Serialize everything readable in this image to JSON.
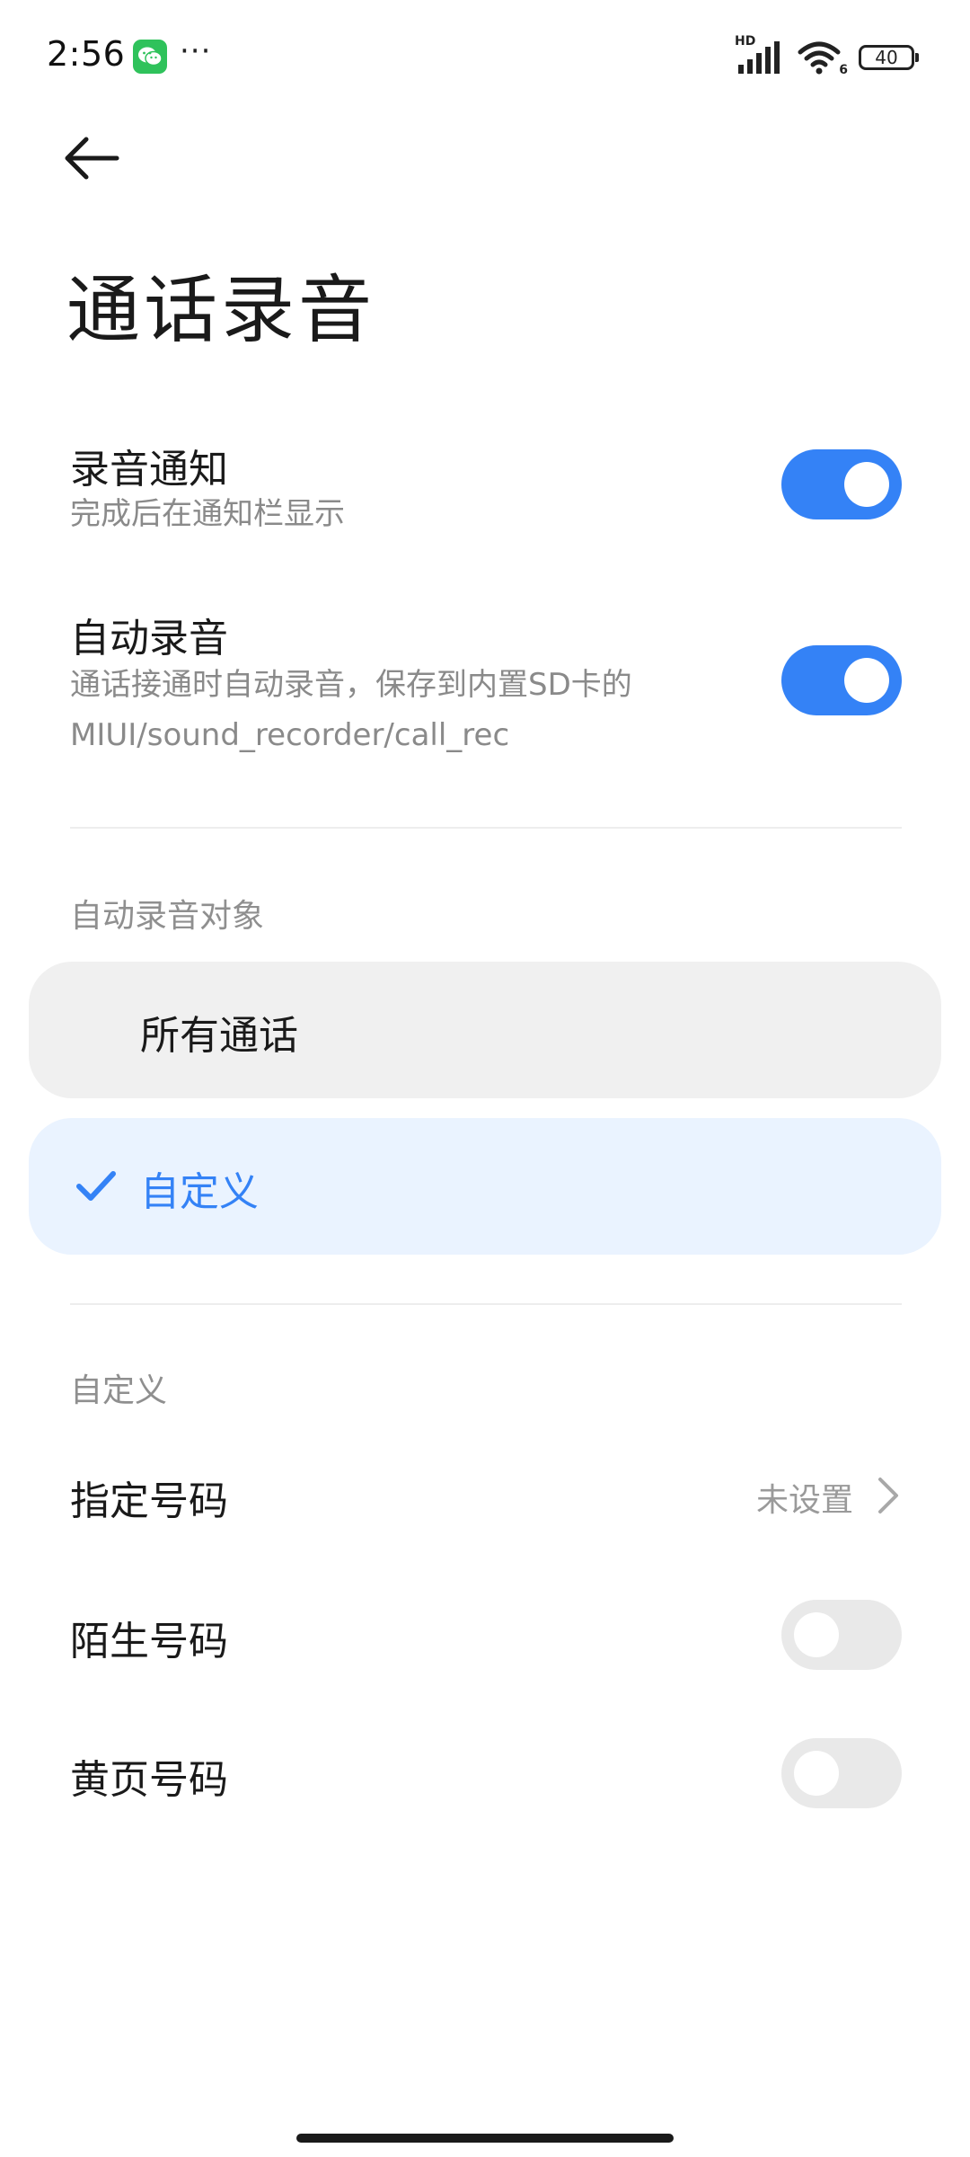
{
  "status_bar": {
    "time": "2:56",
    "app_icon": "wechat-icon",
    "more": "···",
    "network_label": "HD",
    "wifi_label": "6",
    "battery": "40"
  },
  "header": {
    "back_icon": "back-arrow-icon",
    "title": "通话录音"
  },
  "settings": {
    "record_notice": {
      "title": "录音通知",
      "subtitle": "完成后在通知栏显示",
      "enabled": true
    },
    "auto_record": {
      "title": "自动录音",
      "subtitle_line1": "通话接通时自动录音，保存到内置SD卡的",
      "subtitle_line2": "MIUI/sound_recorder/call_rec",
      "enabled": true
    }
  },
  "target_section": {
    "header": "自动录音对象",
    "options": [
      {
        "label": "所有通话",
        "selected": false
      },
      {
        "label": "自定义",
        "selected": true
      }
    ]
  },
  "custom_section": {
    "header": "自定义",
    "specified_numbers": {
      "title": "指定号码",
      "value": "未设置"
    },
    "unknown_numbers": {
      "title": "陌生号码",
      "enabled": false
    },
    "yellow_pages": {
      "title": "黄页号码",
      "enabled": false
    }
  },
  "colors": {
    "accent": "#3482f6",
    "toggle_off": "#e9e9e9",
    "selected_bg": "#eaf3ff",
    "plain_bg": "#f0f0f0"
  }
}
